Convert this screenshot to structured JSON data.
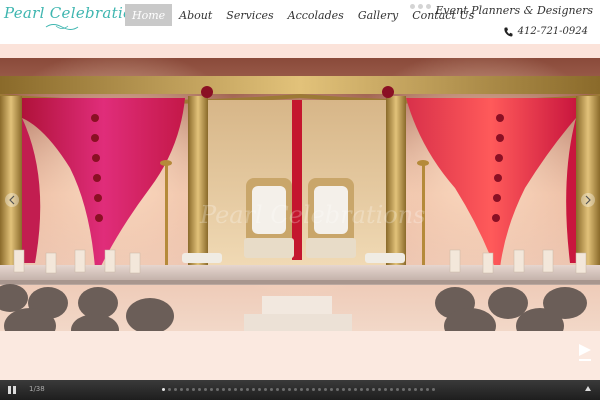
{
  "brand": {
    "logo_text": "Pearl Celebrations"
  },
  "nav": {
    "items": [
      {
        "label": "Home",
        "active": true
      },
      {
        "label": "About",
        "active": false
      },
      {
        "label": "Services",
        "active": false
      },
      {
        "label": "Accolades",
        "active": false
      },
      {
        "label": "Gallery",
        "active": false
      },
      {
        "label": "Contact Us",
        "active": false
      }
    ]
  },
  "header": {
    "tagline": "Event Planners & Designers",
    "phone": "412-721-0924",
    "social_icons": [
      "social-icon-1",
      "social-icon-2",
      "social-icon-3"
    ]
  },
  "slideshow": {
    "counter": "1/38",
    "total_slides": 38,
    "current_slide": 1,
    "watermark_text": "Pearl Celebrations",
    "image_alt": "Gold mandap stage with red and pink drapes and two white chairs"
  },
  "colors": {
    "brand_teal": "#3fb6b0",
    "nav_active": "#c9c9c9",
    "band_pink": "#fbe3da",
    "bar_dark": "#2a2a2a"
  }
}
